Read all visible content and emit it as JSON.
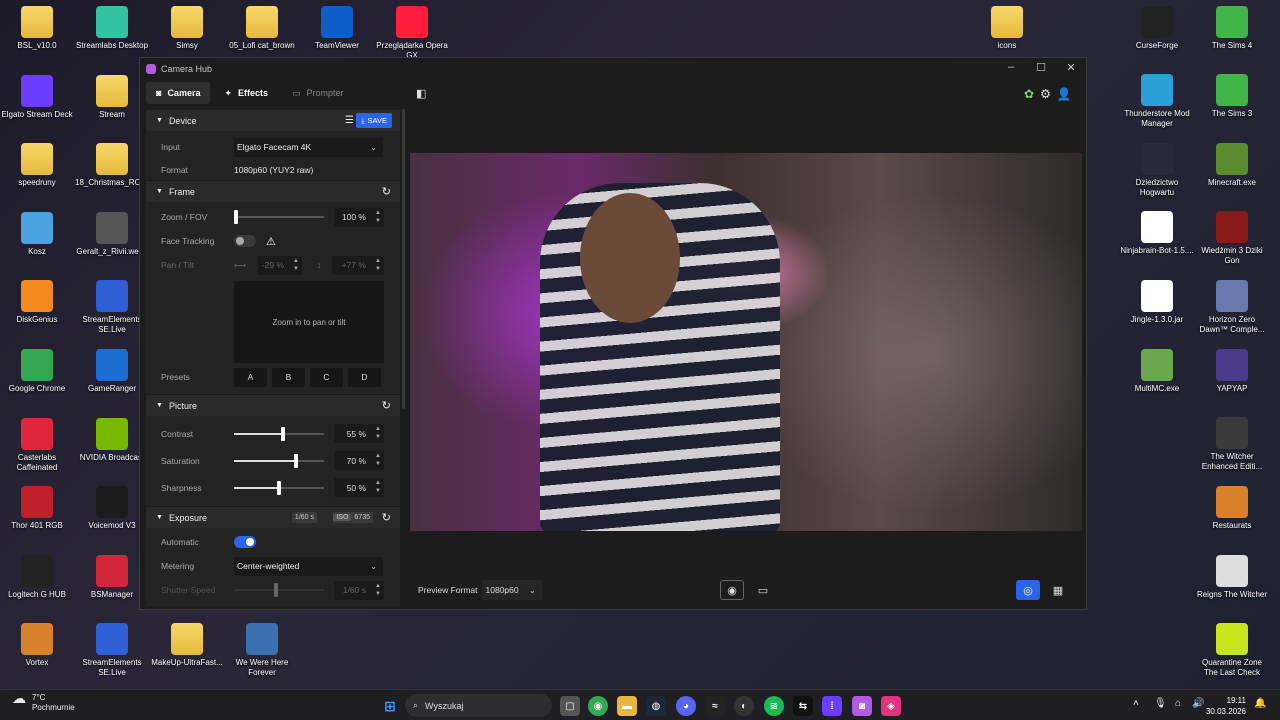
{
  "desktop": {
    "left_icons": [
      {
        "label": "BSL_v10.0",
        "kind": "folder"
      },
      {
        "label": "Streamlabs Desktop",
        "kind": "app",
        "color": "#31c3a2"
      },
      {
        "label": "Simsy",
        "kind": "folder"
      },
      {
        "label": "05_Lofi cat_brown",
        "kind": "folder"
      },
      {
        "label": "TeamViewer",
        "kind": "app",
        "color": "#0e5ec9"
      },
      {
        "label": "Przeglądarka Opera GX",
        "kind": "app",
        "color": "#ff1f3d"
      },
      {
        "label": "Elgato Stream Deck",
        "kind": "app",
        "color": "#6b3dff"
      },
      {
        "label": "Stream",
        "kind": "folder"
      },
      {
        "label": "speedruny",
        "kind": "folder"
      },
      {
        "label": "18_Christmas_RO..._Purple",
        "kind": "folder"
      },
      {
        "label": "Kosz",
        "kind": "app",
        "color": "#4aa3df"
      },
      {
        "label": "Geralt_z_Rivii.webp",
        "kind": "image",
        "color": "#555555"
      },
      {
        "label": "DiskGenius",
        "kind": "app",
        "color": "#f28a1d"
      },
      {
        "label": "StreamElements SE.Live",
        "kind": "app",
        "color": "#2f5fd6"
      },
      {
        "label": "Google Chrome",
        "kind": "app",
        "color": "#34a853"
      },
      {
        "label": "GameRanger",
        "kind": "app",
        "color": "#1a6fd1"
      },
      {
        "label": "Casterlabs Caffeinated",
        "kind": "app",
        "color": "#e0263a"
      },
      {
        "label": "NVIDIA Broadcast",
        "kind": "app",
        "color": "#76b900"
      },
      {
        "label": "Thor 401 RGB",
        "kind": "app",
        "color": "#c0202a"
      },
      {
        "label": "Voicemod V3",
        "kind": "app",
        "color": "#1b1b1b"
      },
      {
        "label": "Logitech G HUB",
        "kind": "app",
        "color": "#222222"
      },
      {
        "label": "BSManager",
        "kind": "app",
        "color": "#d1273a"
      },
      {
        "label": "Vortex",
        "kind": "app",
        "color": "#d9822b"
      },
      {
        "label": "StreamElements SE.Live",
        "kind": "app",
        "color": "#2f5fd6"
      },
      {
        "label": "MakeUp-UltraFast...",
        "kind": "folder"
      },
      {
        "label": "We Were Here Forever",
        "kind": "app",
        "color": "#3a6fb0"
      }
    ],
    "right_icons": [
      {
        "label": "icons",
        "kind": "folder"
      },
      {
        "label": "CurseForge",
        "kind": "app",
        "color": "#222222"
      },
      {
        "label": "The Sims 4",
        "kind": "app",
        "color": "#3fb54a"
      },
      {
        "label": "Thunderstore Mod Manager",
        "kind": "app",
        "color": "#2a9fd8"
      },
      {
        "label": "The Sims 3",
        "kind": "app",
        "color": "#3fb54a"
      },
      {
        "label": "Dziedzictwo Hogwartu",
        "kind": "app",
        "color": "#2a2a3a"
      },
      {
        "label": "Minecraft.exe",
        "kind": "app",
        "color": "#5b8d2f"
      },
      {
        "label": "Ninjabrain-Bot-1.5....",
        "kind": "app",
        "color": "#ffffff"
      },
      {
        "label": "Wiedźmin 3 Dziki Gon",
        "kind": "app",
        "color": "#8a1a1a"
      },
      {
        "label": "Jingle-1.3.0.jar",
        "kind": "app",
        "color": "#ffffff"
      },
      {
        "label": "Horizon Zero Dawn™ Comple...",
        "kind": "app",
        "color": "#6a7ab0"
      },
      {
        "label": "MultiMC.exe",
        "kind": "app",
        "color": "#6aa84f"
      },
      {
        "label": "YAPYAP",
        "kind": "app",
        "color": "#4a3a8a"
      },
      {
        "label": "The Witcher Enhanced Editi...",
        "kind": "app",
        "color": "#3a3a3a"
      },
      {
        "label": "Restaurats",
        "kind": "app",
        "color": "#d9822b"
      },
      {
        "label": "Reigns The Witcher",
        "kind": "app",
        "color": "#dddddd"
      },
      {
        "label": "Quarantine Zone The Last Check",
        "kind": "app",
        "color": "#c8e61e"
      }
    ]
  },
  "window": {
    "title": "Camera Hub",
    "tabs": [
      {
        "label": "Camera",
        "icon": "camera-icon"
      },
      {
        "label": "Effects",
        "icon": "wand-icon"
      },
      {
        "label": "Prompter",
        "icon": "prompter-icon"
      }
    ],
    "device": {
      "title": "Device",
      "save_label": "SAVE",
      "input_label": "Input",
      "input_value": "Elgato Facecam 4K",
      "format_label": "Format",
      "format_value": "1080p60 (YUY2 raw)"
    },
    "frame": {
      "title": "Frame",
      "zoom_label": "Zoom / FOV",
      "zoom_value": "100 %",
      "zoom_level": 0.0,
      "face_tracking_label": "Face Tracking",
      "face_tracking_on": false,
      "pan_tilt_label": "Pan / Tilt",
      "pan_value": "-29 %",
      "tilt_value": "+77 %",
      "pad_hint": "Zoom in to pan or tilt",
      "presets_label": "Presets",
      "presets": [
        "A",
        "B",
        "C",
        "D"
      ]
    },
    "picture": {
      "title": "Picture",
      "contrast_label": "Contrast",
      "contrast_value": "55 %",
      "contrast_level": 0.55,
      "saturation_label": "Saturation",
      "saturation_value": "70 %",
      "saturation_level": 0.7,
      "sharpness_label": "Sharpness",
      "sharpness_value": "50 %",
      "sharpness_level": 0.5
    },
    "exposure": {
      "title": "Exposure",
      "shutter_chip": "1/60 s",
      "iso_chip_label": "ISO",
      "iso_chip_value": "6735",
      "automatic_label": "Automatic",
      "automatic_on": true,
      "metering_label": "Metering",
      "metering_value": "Center-weighted",
      "shutter_label": "Shutter Speed",
      "shutter_value": "1/60 s"
    },
    "preview": {
      "format_label": "Preview Format",
      "format_value": "1080p60"
    }
  },
  "taskbar": {
    "weather_temp": "7°C",
    "weather_desc": "Pochmurnie",
    "search_placeholder": "Wyszukaj",
    "time": "19:11",
    "date": "30.03.2026"
  }
}
